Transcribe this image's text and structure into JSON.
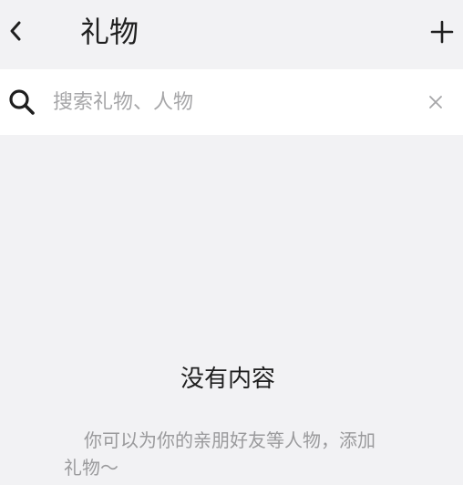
{
  "header": {
    "title": "礼物",
    "back_icon": "chevron-left-icon",
    "add_icon": "plus-icon"
  },
  "search": {
    "placeholder": "搜索礼物、人物",
    "value": "",
    "search_icon": "search-icon",
    "clear_icon": "close-icon"
  },
  "empty_state": {
    "title": "没有内容",
    "description": "你可以为你的亲朋好友等人物，添加礼物～"
  },
  "colors": {
    "background": "#f2f2f4",
    "search_bg": "#ffffff",
    "title_text": "#1f1f1f",
    "muted_text": "#9a9a9c",
    "placeholder_text": "#a6a6a8"
  }
}
